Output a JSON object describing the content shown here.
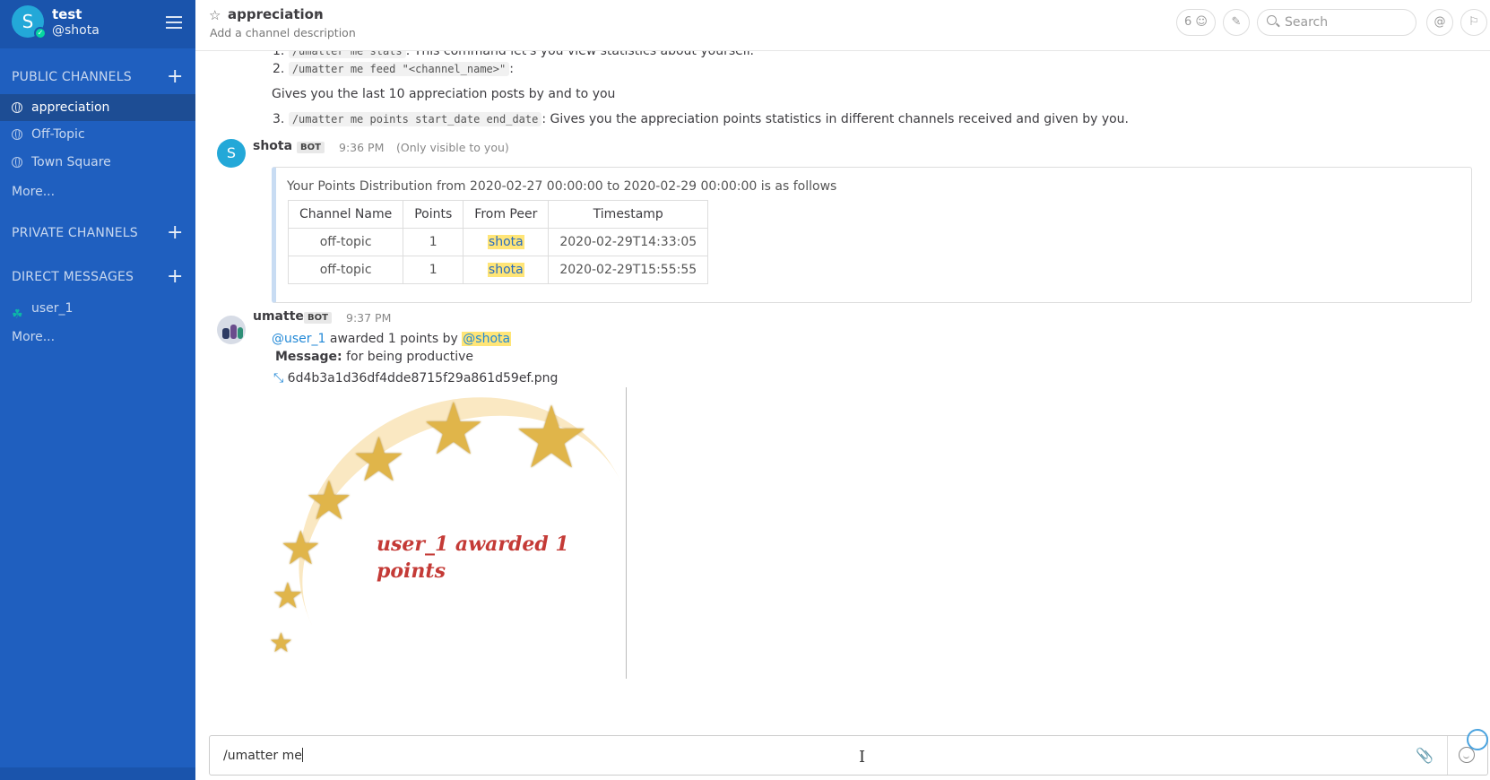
{
  "sidebar": {
    "avatar_letter": "S",
    "team_name": "test",
    "user_handle": "@shota",
    "public_title": "PUBLIC CHANNELS",
    "public_channels": [
      {
        "label": "appreciation",
        "active": true
      },
      {
        "label": "Off-Topic",
        "active": false
      },
      {
        "label": "Town Square",
        "active": false
      }
    ],
    "public_more": "More...",
    "private_title": "PRIVATE CHANNELS",
    "direct_title": "DIRECT MESSAGES",
    "direct_messages": [
      {
        "label": "user_1"
      }
    ],
    "direct_more": "More..."
  },
  "header": {
    "channel_name": "appreciation",
    "description": "Add a channel description",
    "member_count": "6",
    "search_placeholder": "Search"
  },
  "messages": {
    "intro": {
      "item1_num": "1.",
      "item1_code": "/umatter me stats",
      "item1_text": ": This command let's you view statistics about yourself.",
      "item2_num": "2.",
      "item2_code": "/umatter me feed \"<channel_name>\"",
      "item2_text": ":",
      "feed_desc": "Gives you the last 10 appreciation posts by and to you",
      "item3_num": "3.",
      "item3_code": "/umatter me points start_date end_date",
      "item3_text": ": Gives you the appreciation points statistics in different channels received and given by you."
    },
    "shota_post": {
      "avatar_letter": "S",
      "author": "shota",
      "bot_tag": "BOT",
      "time": "9:36 PM",
      "visibility": "(Only visible to you)",
      "attachment_text": "Your Points Distribution from 2020-02-27 00:00:00 to 2020-02-29 00:00:00 is as follows",
      "table_headers": [
        "Channel Name",
        "Points",
        "From Peer",
        "Timestamp"
      ],
      "table_rows": [
        [
          "off-topic",
          "1",
          "shota",
          "2020-02-29T14:33:05"
        ],
        [
          "off-topic",
          "1",
          "shota",
          "2020-02-29T15:55:55"
        ]
      ]
    },
    "umatter_post": {
      "author": "umatter",
      "bot_tag": "BOT",
      "time": "9:37 PM",
      "mention_user": "@user_1",
      "awarded_text": "awarded 1 points by",
      "mention_by": "@shota",
      "message_label": "Message:",
      "message_text": "for being productive",
      "file_name": "6d4b3a1d36df4dde8715f29a861d59ef.png",
      "image_text_line1": "user_1 awarded 1",
      "image_text_line2": "points"
    }
  },
  "composer": {
    "value": "/umatter me"
  },
  "colors": {
    "sidebar_bg": "#1f5fbf",
    "sidebar_active": "#1d4d94",
    "mention": "#2389d7",
    "highlight": "#ffe577",
    "award_text": "#c43a36"
  }
}
